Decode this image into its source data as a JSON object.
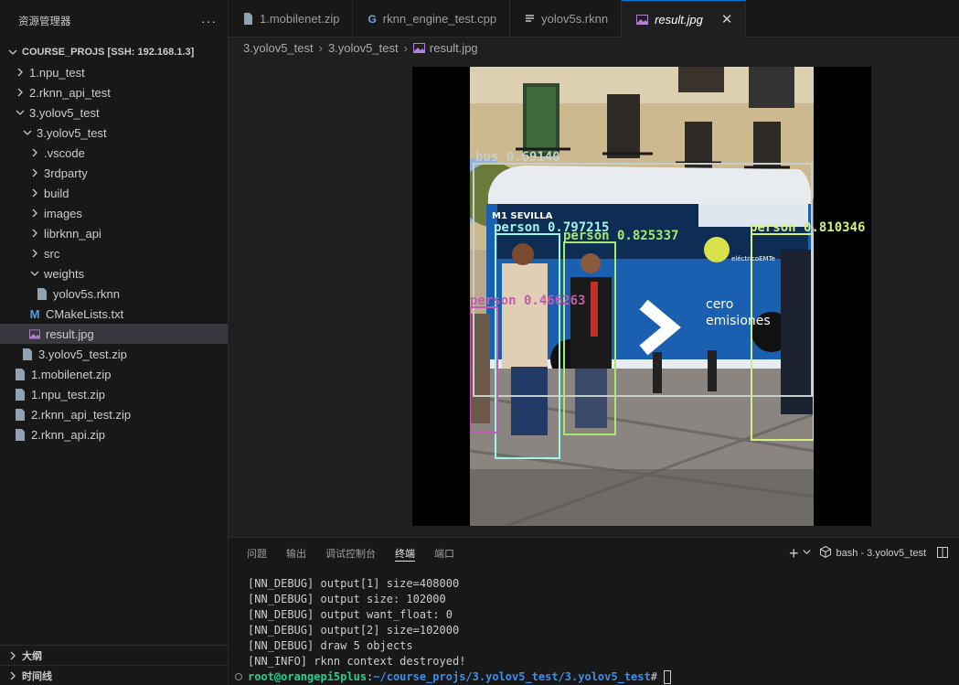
{
  "explorer": {
    "title": "资源管理器",
    "more": "···",
    "root_label": "COURSE_PROJS [SSH: 192.168.1.3]",
    "items": [
      {
        "label": "1.npu_test",
        "type": "folder",
        "expanded": false
      },
      {
        "label": "2.rknn_api_test",
        "type": "folder",
        "expanded": false
      },
      {
        "label": "3.yolov5_test",
        "type": "folder",
        "expanded": true
      },
      {
        "label": "3.yolov5_test",
        "type": "folder",
        "expanded": true
      },
      {
        "label": ".vscode",
        "type": "folder",
        "expanded": false
      },
      {
        "label": "3rdparty",
        "type": "folder",
        "expanded": false
      },
      {
        "label": "build",
        "type": "folder",
        "expanded": false
      },
      {
        "label": "images",
        "type": "folder",
        "expanded": false
      },
      {
        "label": "librknn_api",
        "type": "folder",
        "expanded": false
      },
      {
        "label": "src",
        "type": "folder",
        "expanded": false
      },
      {
        "label": "weights",
        "type": "folder",
        "expanded": true
      },
      {
        "label": "yolov5s.rknn",
        "type": "file"
      },
      {
        "label": "CMakeLists.txt",
        "type": "cmake"
      },
      {
        "label": "result.jpg",
        "type": "image",
        "selected": true
      },
      {
        "label": "3.yolov5_test.zip",
        "type": "file"
      },
      {
        "label": "1.mobilenet.zip",
        "type": "file"
      },
      {
        "label": "1.npu_test.zip",
        "type": "file"
      },
      {
        "label": "2.rknn_api_test.zip",
        "type": "file"
      },
      {
        "label": "2.rknn_api.zip",
        "type": "file"
      }
    ],
    "outline_label": "大纲",
    "timeline_label": "时间线"
  },
  "tabs": [
    {
      "label": "1.mobilenet.zip",
      "icon": "file-icon"
    },
    {
      "label": "rknn_engine_test.cpp",
      "icon": "cpp-icon"
    },
    {
      "label": "yolov5s.rknn",
      "icon": "lines-icon"
    },
    {
      "label": "result.jpg",
      "icon": "image-icon",
      "active": true
    }
  ],
  "tab_close": "✕",
  "breadcrumb": [
    "3.yolov5_test",
    "3.yolov5_test",
    "result.jpg"
  ],
  "detections": [
    {
      "label": "bus 0.69140"
    },
    {
      "label": "person 0.797215"
    },
    {
      "label": "person 0.825337"
    },
    {
      "label": "person 0.810346"
    },
    {
      "label": "person 0.466263"
    }
  ],
  "photo_text": {
    "bus_route": "M1 SEVILLA",
    "bus_slogan_1": "cero",
    "bus_slogan_2": "emisiones",
    "bus_logo_text": "eléctricoEMTe"
  },
  "panel": {
    "tabs": [
      "问题",
      "输出",
      "调试控制台",
      "终端",
      "端口"
    ],
    "active_tab": "终端",
    "add": "+",
    "terminal_name": "bash - 3.yolov5_test"
  },
  "terminal": {
    "lines": [
      "[NN_DEBUG] output[1] size=408000",
      "[NN_DEBUG] output size: 102000",
      "[NN_DEBUG] output want_float: 0",
      "[NN_DEBUG] output[2] size=102000",
      "[NN_DEBUG] draw 5 objects",
      "[NN_INFO] rknn context destroyed!"
    ],
    "prompt_user": "root@orangepi5plus",
    "prompt_sep": ":",
    "prompt_path": "~/course_projs/3.yolov5_test/3.yolov5_test",
    "prompt_end": "# "
  },
  "colors": {
    "accent": "#0078d4",
    "bus_box": "#c8cfc8",
    "person_box_1": "#9ff5e6",
    "person_box_2": "#a6e86b",
    "person_box_3": "#d2f07a",
    "person_box_4": "#c25bb0"
  }
}
